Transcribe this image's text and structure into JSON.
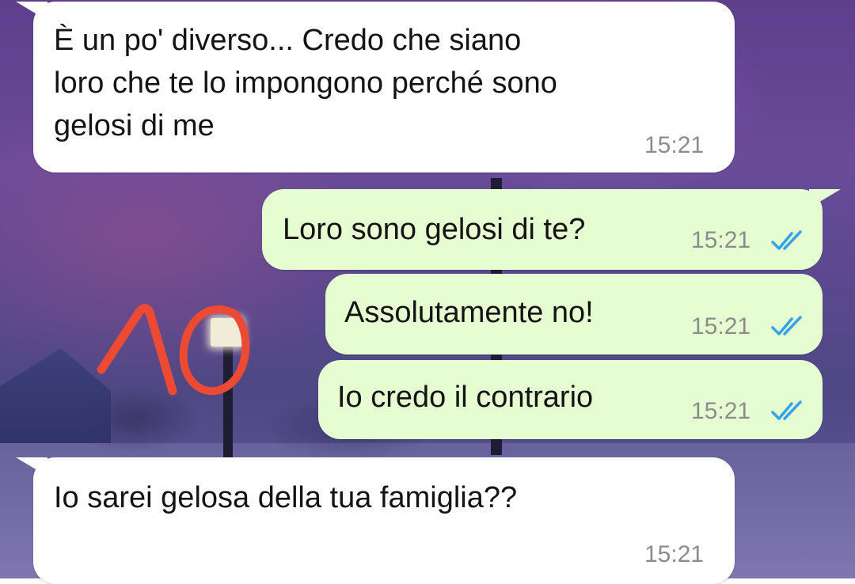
{
  "colors": {
    "incoming_bubble": "#ffffff",
    "outgoing_bubble": "#e6fdd2",
    "read_ticks": "#34a3e8",
    "doodle": "#ec4a33"
  },
  "icons": {
    "read_receipt": "double-check-icon",
    "doodle": "hand-drawn-number-10"
  },
  "messages": [
    {
      "direction": "incoming",
      "text": "È un po' diverso... Credo che siano\nloro che te lo impongono perché sono\ngelosi di me",
      "time": "15:21"
    },
    {
      "direction": "outgoing",
      "text": "Loro sono gelosi di te?",
      "time": "15:21",
      "status": "read"
    },
    {
      "direction": "outgoing",
      "text": "Assolutamente no!",
      "time": "15:21",
      "status": "read"
    },
    {
      "direction": "outgoing",
      "text": "Io credo il contrario",
      "time": "15:21",
      "status": "read"
    },
    {
      "direction": "incoming",
      "text": "Io sarei gelosa della tua famiglia??",
      "time": "15:21"
    }
  ]
}
